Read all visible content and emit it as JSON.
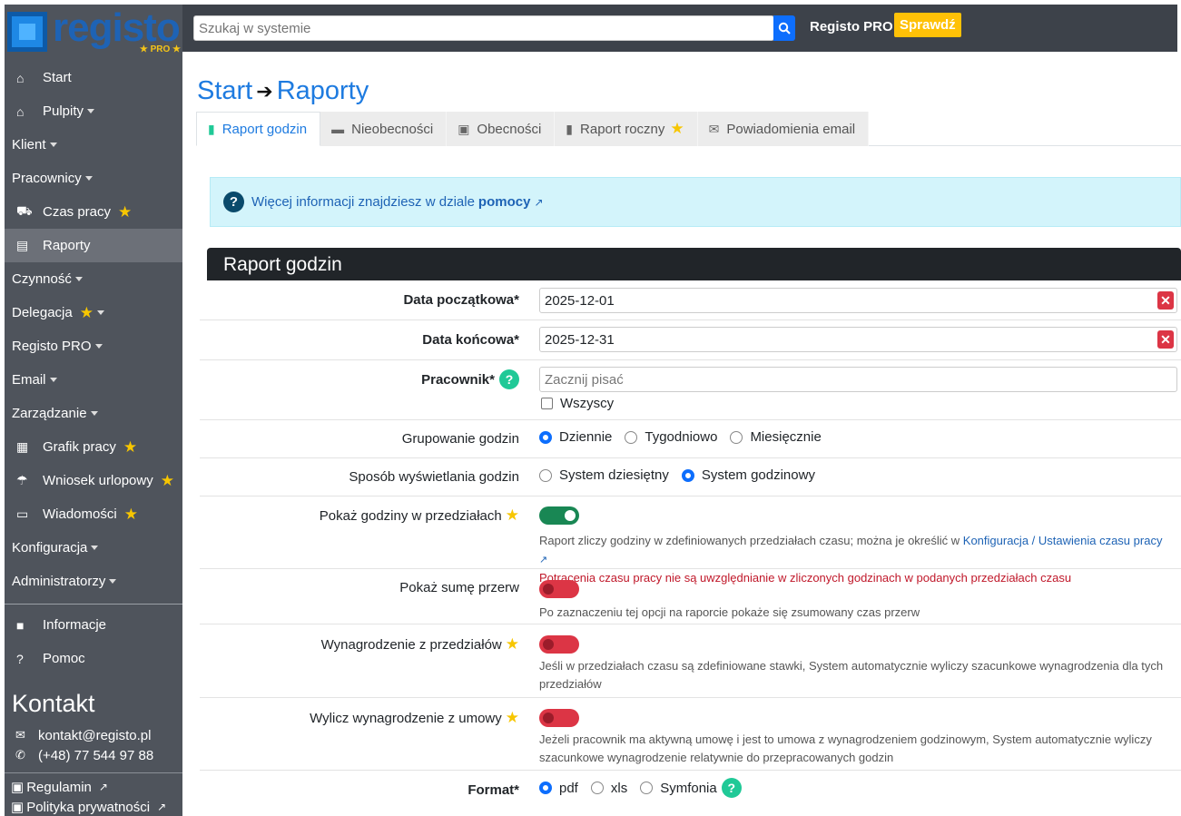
{
  "brand": {
    "logo_text": "registo",
    "pro_badge": "★ PRO ★"
  },
  "sidebar": {
    "items": [
      {
        "label": "Start",
        "icon": "home-icon"
      },
      {
        "label": "Pulpity",
        "icon": "home-icon",
        "caret": true
      },
      {
        "label": "Klient",
        "caret": true
      },
      {
        "label": "Pracownicy",
        "caret": true
      },
      {
        "label": "Czas pracy",
        "icon": "truck-icon",
        "star": true
      },
      {
        "label": "Raporty",
        "icon": "report-icon",
        "active": true
      },
      {
        "label": "Czynność",
        "caret": true
      },
      {
        "label": "Delegacja",
        "star": true,
        "caret": true
      },
      {
        "label": "Registo PRO",
        "caret": true
      },
      {
        "label": "Email",
        "caret": true
      },
      {
        "label": "Zarządzanie",
        "caret": true
      },
      {
        "label": "Grafik pracy",
        "icon": "calendar-icon",
        "star": true
      },
      {
        "label": "Wniosek urlopowy",
        "icon": "umbrella-icon",
        "star": true
      },
      {
        "label": "Wiadomości",
        "icon": "message-icon",
        "star": true
      },
      {
        "label": "Konfiguracja",
        "caret": true
      },
      {
        "label": "Administratorzy",
        "caret": true
      }
    ],
    "info_label": "Informacje",
    "help_label": "Pomoc",
    "kontakt_title": "Kontakt",
    "email": "kontakt@registo.pl",
    "phone": "(+48) 77 544 97 88",
    "regulamin": "Regulamin",
    "polityka": "Polityka prywatności"
  },
  "topbar": {
    "search_placeholder": "Szukaj w systemie",
    "pro_label": "Registo PRO",
    "check_button": "Sprawdź"
  },
  "breadcrumb": {
    "home": "Start",
    "current": "Raporty"
  },
  "tabs": [
    {
      "label": "Raport godzin",
      "icon": "clipboard-icon",
      "active": true
    },
    {
      "label": "Nieobecności",
      "icon": "bed-icon"
    },
    {
      "label": "Obecności",
      "icon": "calendar-check-icon"
    },
    {
      "label": "Raport roczny",
      "icon": "clipboard-check-icon",
      "star": true
    },
    {
      "label": "Powiadomienia email",
      "icon": "envelope-open-icon"
    }
  ],
  "info": {
    "text": "Więcej informacji znajdziesz w dziale",
    "link": "pomocy"
  },
  "section_title": "Raport godzin",
  "form": {
    "start_date_label": "Data początkowa*",
    "start_date_value": "2025-12-01",
    "end_date_label": "Data końcowa*",
    "end_date_value": "2025-12-31",
    "employee_label": "Pracownik*",
    "employee_placeholder": "Zacznij pisać",
    "all_label": "Wszyscy",
    "grouping_label": "Grupowanie godzin",
    "grouping_options": [
      "Dziennie",
      "Tygodniowo",
      "Miesięcznie"
    ],
    "grouping_selected": "Dziennie",
    "display_label": "Sposób wyświetlania godzin",
    "display_options": [
      "System dziesiętny",
      "System godzinowy"
    ],
    "display_selected": "System godzinowy",
    "intervals_label": "Pokaż godziny w przedziałach",
    "intervals_on": true,
    "intervals_desc": "Raport zliczy godziny w zdefiniowanych przedziałach czasu; można je określić w",
    "intervals_link": "Konfiguracja / Ustawienia czasu pracy",
    "intervals_warn": "Potrącenia czasu pracy nie są uwzględnianie w zliczonych godzinach w podanych przedziałach czasu",
    "breaks_label": "Pokaż sumę przerw",
    "breaks_on": false,
    "breaks_desc": "Po zaznaczeniu tej opcji na raporcie pokaże się zsumowany czas przerw",
    "salary_intervals_label": "Wynagrodzenie z przedziałów",
    "salary_intervals_on": false,
    "salary_intervals_desc": "Jeśli w przedziałach czasu są zdefiniowane stawki, System automatycznie wyliczy szacunkowe wynagrodzenia dla tych przedziałów",
    "salary_contract_label": "Wylicz wynagrodzenie z umowy",
    "salary_contract_on": false,
    "salary_contract_desc": "Jeżeli pracownik ma aktywną umowę i jest to umowa z wynagrodzeniem godzinowym, System automatycznie wyliczy szacunkowe wynagrodzenie relatywnie do przepracowanych godzin",
    "format_label": "Format*",
    "format_options": [
      "pdf",
      "xls",
      "Symfonia"
    ],
    "format_selected": "pdf"
  },
  "colors": {
    "accent": "#1e7be0",
    "sidebar_bg": "#4f545c",
    "topbar_bg": "#3d424a",
    "success": "#198754",
    "danger": "#dc3545",
    "warning": "#ffc107"
  }
}
